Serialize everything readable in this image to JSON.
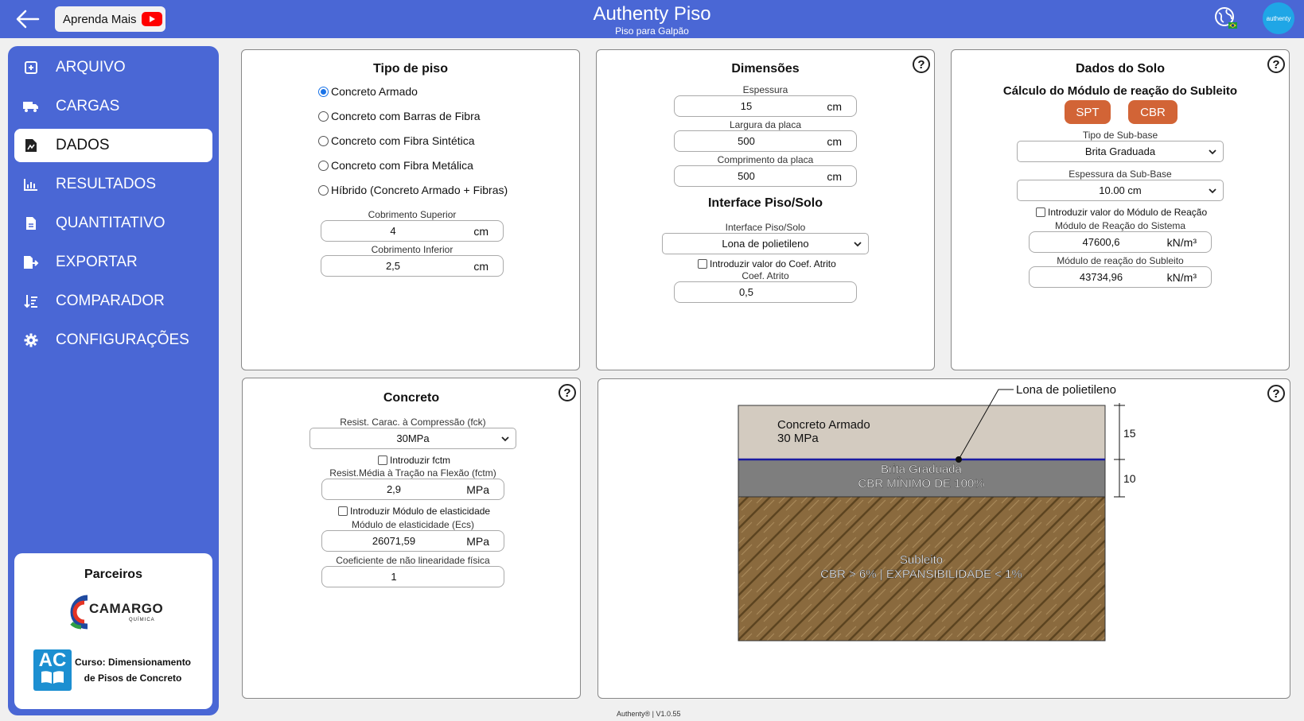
{
  "header": {
    "learn_label": "Aprenda Mais",
    "title": "Authenty Piso",
    "subtitle": "Piso para Galpão",
    "avatar_label": "authenty"
  },
  "sidebar": {
    "items": [
      {
        "label": "ARQUIVO",
        "icon": "file-add-icon"
      },
      {
        "label": "CARGAS",
        "icon": "truck-icon"
      },
      {
        "label": "DADOS",
        "icon": "document-chart-icon",
        "active": true
      },
      {
        "label": "RESULTADOS",
        "icon": "bar-chart-icon"
      },
      {
        "label": "QUANTITATIVO",
        "icon": "document-icon"
      },
      {
        "label": "EXPORTAR",
        "icon": "export-icon"
      },
      {
        "label": "COMPARADOR",
        "icon": "sort-list-icon"
      },
      {
        "label": "CONFIGURAÇÕES",
        "icon": "gear-icon"
      }
    ],
    "partners_title": "Parceiros",
    "camargo_name": "CAMARGO",
    "camargo_sub": "QUÍMICA",
    "course_badge": "AC",
    "course_line1": "Curso: Dimensionamento",
    "course_line2": "de Pisos de Concreto"
  },
  "tipo_piso": {
    "title": "Tipo de piso",
    "options": [
      "Concreto Armado",
      "Concreto com Barras de Fibra",
      "Concreto com Fibra Sintética",
      "Concreto com Fibra Metálica",
      "Híbrido (Concreto Armado + Fibras)"
    ],
    "selected_index": 0,
    "cob_sup_label": "Cobrimento Superior",
    "cob_sup_value": "4",
    "cob_sup_unit": "cm",
    "cob_inf_label": "Cobrimento Inferior",
    "cob_inf_value": "2,5",
    "cob_inf_unit": "cm"
  },
  "dimensoes": {
    "title": "Dimensões",
    "espessura_label": "Espessura",
    "espessura_value": "15",
    "espessura_unit": "cm",
    "largura_label": "Largura da placa",
    "largura_value": "500",
    "largura_unit": "cm",
    "comprimento_label": "Comprimento da placa",
    "comprimento_value": "500",
    "comprimento_unit": "cm",
    "interface_title": "Interface Piso/Solo",
    "interface_label": "Interface Piso/Solo",
    "interface_value": "Lona de polietileno",
    "coef_check_label": "Introduzir valor do Coef. Atrito",
    "coef_label": "Coef. Atrito",
    "coef_value": "0,5"
  },
  "solo": {
    "title": "Dados do Solo",
    "subtitle": "Cálculo do Módulo de reação do Subleito",
    "spt_label": "SPT",
    "cbr_label": "CBR",
    "subbase_type_label": "Tipo de Sub-base",
    "subbase_type_value": "Brita Graduada",
    "subbase_thick_label": "Espessura da Sub-Base",
    "subbase_thick_value": "10.00 cm",
    "modulo_check_label": "Introduzir valor do Módulo de Reação",
    "modulo_sistema_label": "Módulo de Reação do Sistema",
    "modulo_sistema_value": "47600,6",
    "modulo_sistema_unit": "kN/m³",
    "modulo_subleito_label": "Módulo de reação do Subleito",
    "modulo_subleito_value": "43734,96",
    "modulo_subleito_unit": "kN/m³"
  },
  "concreto": {
    "title": "Concreto",
    "fck_label": "Resist. Carac. à Compressão (fck)",
    "fck_value": "30MPa",
    "fctm_check_label": "Introduzir fctm",
    "fctm_label": "Resist.Média à Tração na Flexão (fctm)",
    "fctm_value": "2,9",
    "fctm_unit": "MPa",
    "ecs_check_label": "Introduzir Módulo de elasticidade",
    "ecs_label": "Módulo de elasticidade (Ecs)",
    "ecs_value": "26071,59",
    "ecs_unit": "MPa",
    "nl_label": "Coeficiente de não linearidade física",
    "nl_value": "1"
  },
  "diagram": {
    "interface_callout": "Lona de polietileno",
    "layer1_line1": "Concreto Armado",
    "layer1_line2": "30 MPa",
    "layer2_line1": "Brita Graduada",
    "layer2_line2": "CBR MÍNIMO DE 100%",
    "layer3_line1": "Subleito",
    "layer3_line2": "CBR > 6% | EXPANSIBILIDADE < 1%",
    "dim1": "15",
    "dim2": "10",
    "colors": {
      "concrete": "#d3cbc0",
      "gravel": "#7e7e7e",
      "soil": "#8a6a3e",
      "interface": "#1a1aa0"
    }
  },
  "footer": {
    "version": "Authenty® | V1.0.55"
  }
}
